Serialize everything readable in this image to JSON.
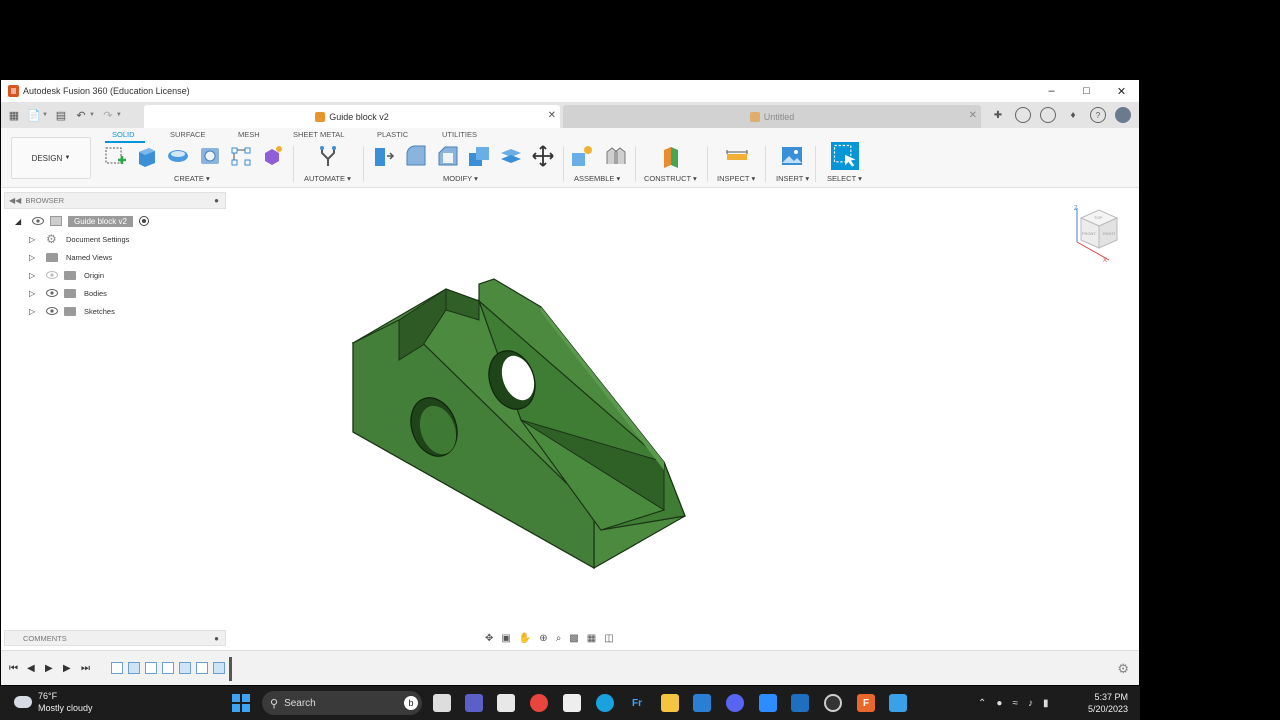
{
  "window": {
    "title": "Autodesk Fusion 360 (Education License)"
  },
  "tabs": [
    {
      "label": "Guide block v2",
      "active": true
    },
    {
      "label": "Untitled",
      "active": false
    }
  ],
  "ribbon": {
    "workspace": "DESIGN",
    "workspace_tabs": [
      "SOLID",
      "SURFACE",
      "MESH",
      "SHEET METAL",
      "PLASTIC",
      "UTILITIES"
    ],
    "groups": {
      "create": "CREATE",
      "automate": "AUTOMATE",
      "modify": "MODIFY",
      "assemble": "ASSEMBLE",
      "construct": "CONSTRUCT",
      "inspect": "INSPECT",
      "insert": "INSERT",
      "select": "SELECT"
    },
    "accent": "#0696d7"
  },
  "browser": {
    "title": "BROWSER",
    "root": "Guide block v2",
    "items": [
      "Document Settings",
      "Named Views",
      "Origin",
      "Bodies",
      "Sketches"
    ]
  },
  "viewcube": {
    "top": "TOP",
    "front": "FRONT",
    "right": "RIGHT",
    "axis_z": "Z",
    "axis_x": "X"
  },
  "comments": {
    "title": "COMMENTS"
  },
  "model": {
    "color": "#3f7a35",
    "name": "Guide block v2"
  },
  "taskbar": {
    "weather_temp": "76°F",
    "weather_desc": "Mostly cloudy",
    "search": "Search",
    "time": "5:37 PM",
    "date": "5/20/2023"
  }
}
